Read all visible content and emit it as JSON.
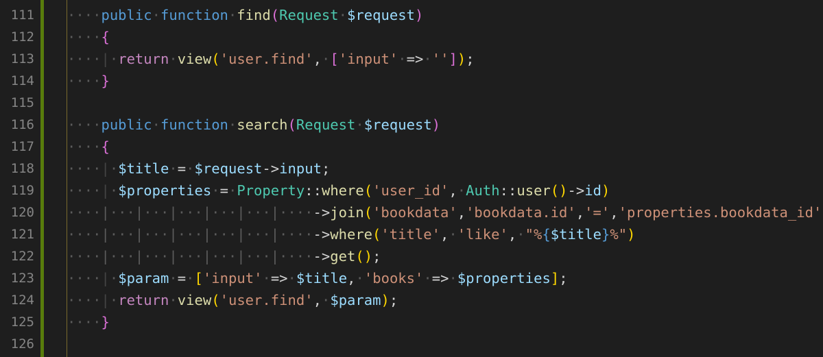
{
  "editor": {
    "colors": {
      "background": "#1e1e1e",
      "git_added_bar": "#587c0c",
      "line_number": "#858585",
      "keyword": "#569cd6",
      "function": "#dcdcaa",
      "type": "#4ec9b0",
      "variable": "#9cdcfe",
      "string": "#ce9178",
      "control": "#c586c0"
    },
    "line_numbers": [
      "111",
      "112",
      "113",
      "114",
      "115",
      "116",
      "117",
      "118",
      "119",
      "120",
      "121",
      "122",
      "123",
      "124",
      "125",
      "126"
    ],
    "lines": {
      "l111": {
        "ws1": "····",
        "kw1": "public",
        "sp1": "·",
        "kw2": "function",
        "sp2": "·",
        "fn": "find",
        "p1": "(",
        "type": "Request",
        "sp3": "·",
        "var": "$request",
        "p2": ")"
      },
      "l112": {
        "ws1": "····",
        "b": "{"
      },
      "l113": {
        "ws1": "····",
        "g": "|",
        "ws2": "·",
        "kw": "return",
        "sp1": "·",
        "fn": "view",
        "p1": "(",
        "s1": "'user.find'",
        "c1": ",",
        "sp2": "·",
        "b1": "[",
        "s2": "'input'",
        "sp3": "·",
        "op": "=>",
        "sp4": "·",
        "s3": "''",
        "b2": "]",
        "p2": ")",
        "semi": ";"
      },
      "l114": {
        "ws1": "····",
        "b": "}"
      },
      "l115": {
        "text": ""
      },
      "l116": {
        "ws1": "····",
        "kw1": "public",
        "sp1": "·",
        "kw2": "function",
        "sp2": "·",
        "fn": "search",
        "p1": "(",
        "type": "Request",
        "sp3": "·",
        "var": "$request",
        "p2": ")"
      },
      "l117": {
        "ws1": "····",
        "b": "{"
      },
      "l118": {
        "ws1": "····",
        "g": "|",
        "ws2": "·",
        "var1": "$title",
        "sp1": "·",
        "op": "=",
        "sp2": "·",
        "var2": "$request",
        "arrow": "->",
        "prop": "input",
        "semi": ";"
      },
      "l119": {
        "ws1": "····",
        "g": "|",
        "ws2": "·",
        "var1": "$properties",
        "sp1": "·",
        "op": "=",
        "sp2": "·",
        "type1": "Property",
        "dc1": "::",
        "fn1": "where",
        "p1": "(",
        "s1": "'user_id'",
        "c1": ",",
        "sp3": "·",
        "type2": "Auth",
        "dc2": "::",
        "fn2": "user",
        "p2": "()",
        "arrow": "->",
        "prop": "id",
        "p3": ")"
      },
      "l120": {
        "ws": "····|···|···|···|···|···|····",
        "arrow": "->",
        "fn": "join",
        "p1": "(",
        "s1": "'bookdata'",
        "c1": ",",
        "s2": "'bookdata.id'",
        "c2": ",",
        "s3": "'='",
        "c3": ",",
        "s4": "'properties.bookdata_id'",
        "p2": ")"
      },
      "l121": {
        "ws": "····|···|···|···|···|···|····",
        "arrow": "->",
        "fn": "where",
        "p1": "(",
        "s1": "'title'",
        "c1": ",",
        "sp1": "·",
        "s2": "'like'",
        "c2": ",",
        "sp2": "·",
        "s3a": "\"%",
        "i1": "{",
        "var": "$title",
        "i2": "}",
        "s3b": "%\"",
        "p2": ")"
      },
      "l122": {
        "ws": "····|···|···|···|···|···|····",
        "arrow": "->",
        "fn": "get",
        "p1": "()",
        "semi": ";"
      },
      "l123": {
        "ws1": "····",
        "g": "|",
        "ws2": "·",
        "var1": "$param",
        "sp1": "·",
        "op1": "=",
        "sp2": "·",
        "b1": "[",
        "s1": "'input'",
        "sp3": "·",
        "op2": "=>",
        "sp4": "·",
        "var2": "$title",
        "c1": ",",
        "sp5": "·",
        "s2": "'books'",
        "sp6": "·",
        "op3": "=>",
        "sp7": "·",
        "var3": "$properties",
        "b2": "]",
        "semi": ";"
      },
      "l124": {
        "ws1": "····",
        "g": "|",
        "ws2": "·",
        "kw": "return",
        "sp1": "·",
        "fn": "view",
        "p1": "(",
        "s1": "'user.find'",
        "c1": ",",
        "sp2": "·",
        "var": "$param",
        "p2": ")",
        "semi": ";"
      },
      "l125": {
        "ws1": "····",
        "b": "}"
      },
      "l126": {
        "text": ""
      }
    }
  }
}
